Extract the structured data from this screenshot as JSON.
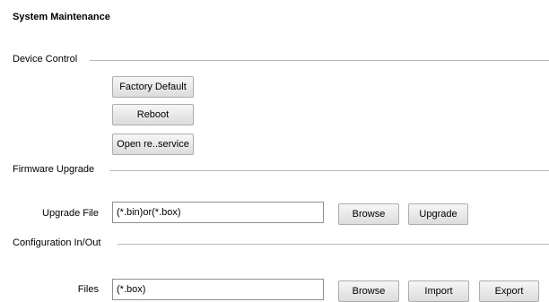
{
  "page": {
    "title": "System Maintenance"
  },
  "device_control": {
    "label": "Device Control",
    "factory_default_label": "Factory Default",
    "reboot_label": "Reboot",
    "open_service_label": "Open re..service"
  },
  "firmware_upgrade": {
    "label": "Firmware Upgrade",
    "upgrade_file_label": "Upgrade File",
    "upgrade_file_value": "(*.bin)or(*.box)",
    "browse_label": "Browse",
    "upgrade_label": "Upgrade"
  },
  "configuration": {
    "label": "Configuration In/Out",
    "files_label": "Files",
    "files_value": "(*.box)",
    "browse_label": "Browse",
    "import_label": "Import",
    "export_label": "Export"
  }
}
